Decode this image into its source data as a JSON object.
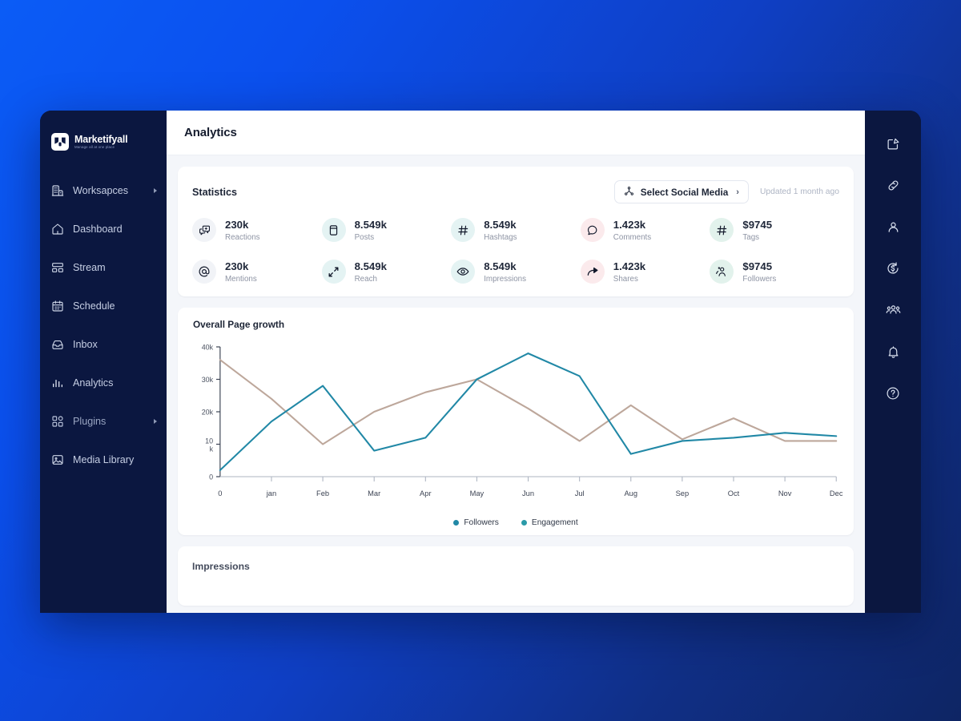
{
  "brand": {
    "name": "Marketifyall",
    "tagline": "Manage all at one place",
    "logo_icon": "marketifyall-logo-icon"
  },
  "topbar": {
    "title": "Analytics"
  },
  "sidebar": {
    "items": [
      {
        "label": "Worksapces",
        "icon": "building-icon",
        "has_caret": true
      },
      {
        "label": "Dashboard",
        "icon": "home-icon",
        "has_caret": false
      },
      {
        "label": "Stream",
        "icon": "stream-icon",
        "has_caret": false
      },
      {
        "label": "Schedule",
        "icon": "calendar-icon",
        "has_caret": false
      },
      {
        "label": "Inbox",
        "icon": "inbox-icon",
        "has_caret": false
      },
      {
        "label": "Analytics",
        "icon": "bar-chart-icon",
        "has_caret": false
      },
      {
        "label": "Plugins",
        "icon": "grid-icon",
        "has_caret": true
      },
      {
        "label": "Media Library",
        "icon": "image-icon",
        "has_caret": false
      }
    ]
  },
  "right_rail": {
    "items": [
      {
        "icon": "compose-edit-icon"
      },
      {
        "icon": "link-icon"
      },
      {
        "icon": "user-icon"
      },
      {
        "icon": "dollar-refresh-icon"
      },
      {
        "icon": "users-group-icon"
      },
      {
        "icon": "bell-icon"
      },
      {
        "icon": "help-circle-icon"
      }
    ]
  },
  "statistics": {
    "title": "Statistics",
    "select_social_label": "Select Social Media",
    "select_social_icon": "share-nodes-icon",
    "select_social_chevron": "›",
    "updated_text": "Updated 1 month ago",
    "metrics": [
      {
        "value": "230k",
        "label": "Reactions",
        "icon": "reactions-icon",
        "bg": "#f1f3f7"
      },
      {
        "value": "8.549k",
        "label": "Posts",
        "icon": "posts-icon",
        "bg": "#e4f3f3"
      },
      {
        "value": "8.549k",
        "label": "Hashtags",
        "icon": "hashtag-icon",
        "bg": "#e4f3f3"
      },
      {
        "value": "1.423k",
        "label": "Comments",
        "icon": "comment-icon",
        "bg": "#fbeaec"
      },
      {
        "value": "$9745",
        "label": "Tags",
        "icon": "hashtag-icon",
        "bg": "#e2f2ec"
      },
      {
        "value": "230k",
        "label": "Mentions",
        "icon": "mention-at-icon",
        "bg": "#f1f3f7"
      },
      {
        "value": "8.549k",
        "label": "Reach",
        "icon": "expand-arrows-icon",
        "bg": "#e4f3f3"
      },
      {
        "value": "8.549k",
        "label": "Impressions",
        "icon": "eye-icon",
        "bg": "#e4f3f3"
      },
      {
        "value": "1.423k",
        "label": "Shares",
        "icon": "share-arrow-icon",
        "bg": "#fbeaec"
      },
      {
        "value": "$9745",
        "label": "Followers",
        "icon": "followers-icon",
        "bg": "#e2f2ec"
      }
    ]
  },
  "impressions": {
    "title": "Impressions"
  },
  "chart_data": {
    "type": "line",
    "title": "Overall Page growth",
    "xlabel": "",
    "ylabel": "",
    "grid": false,
    "legend_position": "bottom",
    "x": [
      "0",
      "jan",
      "Feb",
      "Mar",
      "Apr",
      "May",
      "Jun",
      "Jul",
      "Aug",
      "Sep",
      "Oct",
      "Nov",
      "Dec"
    ],
    "xtick_labels": [
      "0",
      "jan",
      "Feb",
      "Mar",
      "Apr",
      "May",
      "Jun",
      "Jul",
      "Aug",
      "Sep",
      "Oct",
      "Nov",
      "Dec"
    ],
    "ytick_labels": [
      "0",
      "10 k",
      "20k",
      "30k",
      "40k"
    ],
    "ytick_values": [
      0,
      10000,
      20000,
      30000,
      40000
    ],
    "ylim": [
      0,
      40000
    ],
    "series": [
      {
        "name": "Followers",
        "color": "#bda79b",
        "values": [
          36000,
          24000,
          10000,
          20000,
          26000,
          30000,
          21000,
          11000,
          22000,
          11500,
          18000,
          11000,
          11000
        ]
      },
      {
        "name": "Engagement",
        "color": "#2188a6",
        "values": [
          2000,
          17000,
          28000,
          8000,
          12000,
          30000,
          38000,
          31000,
          7000,
          11000,
          12000,
          13500,
          12500
        ]
      }
    ],
    "legend": [
      {
        "name": "Followers",
        "color": "#2188a6"
      },
      {
        "name": "Engagement",
        "color": "#2a9aa8"
      }
    ]
  },
  "colors": {
    "page_gradient_start": "#0b5cf6",
    "page_gradient_end": "#0e2564",
    "sidebar_bg": "#0b1740",
    "window_bg": "#0d1c46",
    "content_bg": "#f4f6fa",
    "accent_teal": "#2188a6",
    "accent_tan": "#bda79b"
  }
}
